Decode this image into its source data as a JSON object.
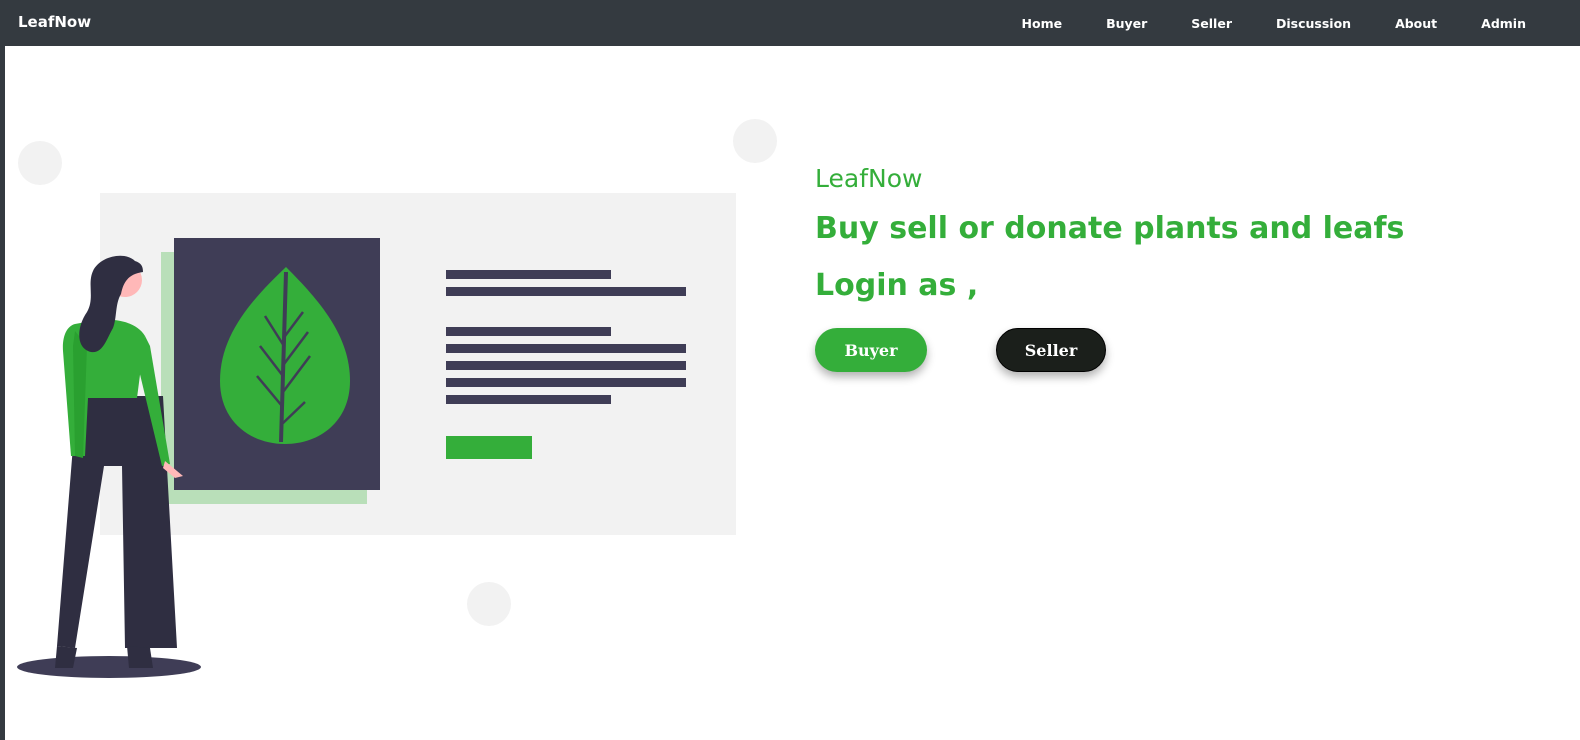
{
  "navbar": {
    "brand": "LeafNow",
    "links": [
      "Home",
      "Buyer",
      "Seller",
      "Discussion",
      "About",
      "Admin"
    ]
  },
  "hero": {
    "brand": "LeafNow",
    "tagline": "Buy sell or donate plants and leafs",
    "login_prompt": "Login as ,",
    "buttons": {
      "buyer": "Buyer",
      "seller": "Seller"
    }
  },
  "colors": {
    "navbar_bg": "#343a40",
    "accent_green": "#34ae3a",
    "dark_button": "#1b1f1b",
    "illustration_panel": "#f2f2f2",
    "illustration_dark": "#3f3d56"
  },
  "icons": [
    "leaf-icon"
  ]
}
